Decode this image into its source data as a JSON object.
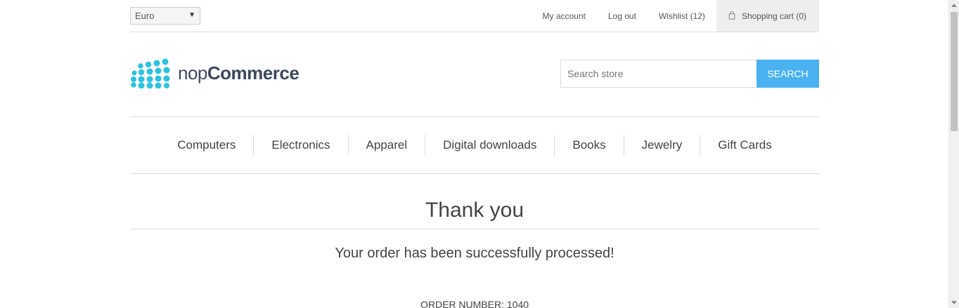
{
  "header": {
    "currency": "Euro",
    "links": {
      "my_account": "My account",
      "log_out": "Log out",
      "wishlist": "Wishlist (12)",
      "shopping_cart": "Shopping cart (0)"
    }
  },
  "logo": {
    "prefix": "nop",
    "brand": "Commerce",
    "icon": "logo-dots-icon",
    "color": "#2cc3de"
  },
  "search": {
    "placeholder": "Search store",
    "button_label": "Search",
    "button_color": "#4ab2f1"
  },
  "menu": {
    "items": [
      "Computers",
      "Electronics",
      "Apparel",
      "Digital downloads",
      "Books",
      "Jewelry",
      "Gift Cards"
    ]
  },
  "content": {
    "title": "Thank you",
    "message": "Your order has been successfully processed!",
    "order_number": "Order number: 1040"
  }
}
